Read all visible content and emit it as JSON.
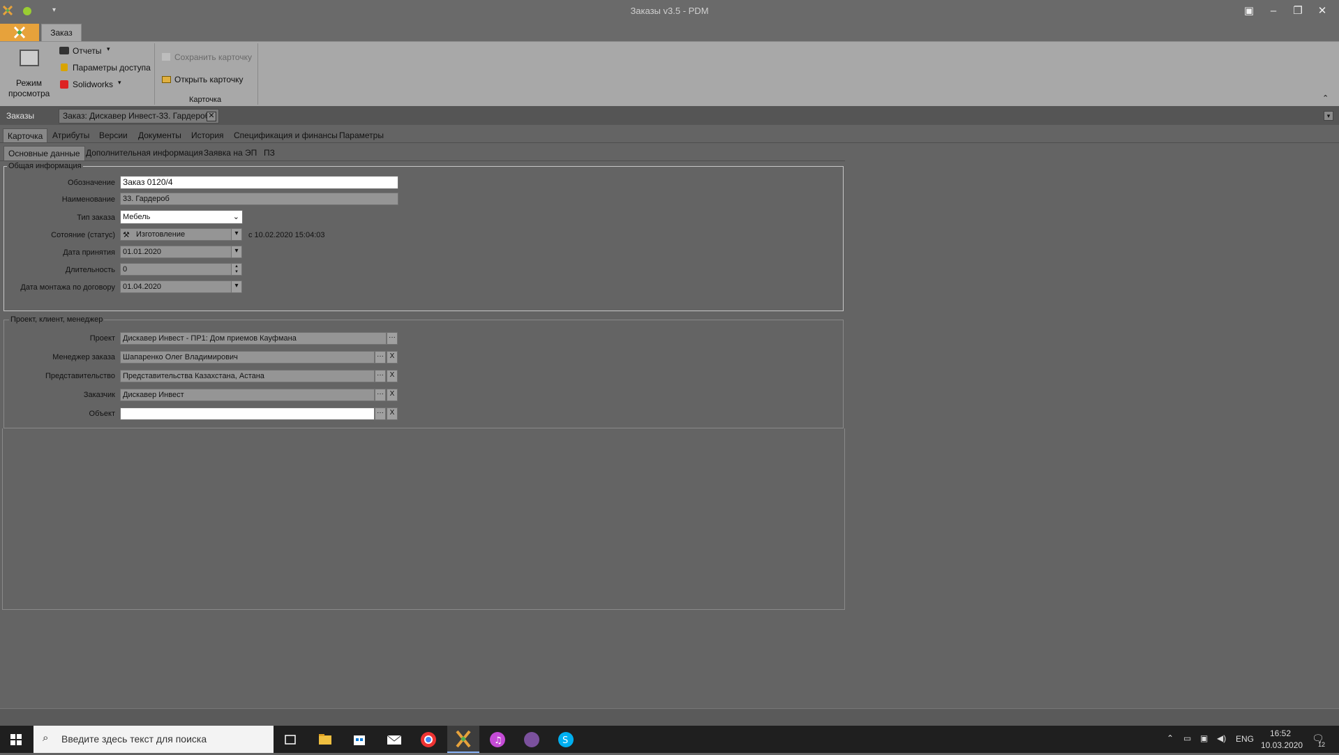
{
  "window": {
    "title": "Заказы v3.5 - PDM"
  },
  "ribbon": {
    "tab": "Заказ",
    "view_mode_line1": "Режим",
    "view_mode_line2": "просмотра",
    "reports": "Отчеты",
    "access_params": "Параметры доступа",
    "solidworks": "Solidworks",
    "save_card": "Сохранить карточку",
    "open_card": "Открыть карточку",
    "group_card": "Карточка"
  },
  "doc_strip": {
    "root_label": "Заказы",
    "open_tab": "Заказ: Дискавер Инвест-33. Гардероб",
    "close_glyph": "✕"
  },
  "tabs_main": [
    "Карточка",
    "Атрибуты",
    "Версии",
    "Документы",
    "История",
    "Спецификация и финансы",
    "Параметры"
  ],
  "tabs_sub": [
    "Основные данные",
    "Дополнительная информация",
    "Заявка на ЭП",
    "ПЗ"
  ],
  "general": {
    "title": "Общая информация",
    "designation_label": "Обозначение",
    "designation_value": "Заказ 0120/4",
    "name_label": "Наименование",
    "name_value": "33. Гардероб",
    "type_label": "Тип заказа",
    "type_value": "Мебель",
    "status_label": "Сотояние (статус)",
    "status_value": "Изготовление",
    "status_since": "с 10.02.2020 15:04:03",
    "accept_date_label": "Дата принятия",
    "accept_date_value": "01.01.2020",
    "duration_label": "Длительность",
    "duration_value": "0",
    "mount_date_label": "Дата монтажа по договору",
    "mount_date_value": "01.04.2020"
  },
  "project": {
    "title": "Проект, клиент, менеджер",
    "project_label": "Проект",
    "project_value": "Дискавер Инвест - ПР1: Дом приемов Кауфмана",
    "manager_label": "Менеджер заказа",
    "manager_value": "Шапаренко Олег Владимирович",
    "office_label": "Представительство",
    "office_value": "Представительства Казахстана, Астана",
    "customer_label": "Заказчик",
    "customer_value": "Дискавер Инвест",
    "object_label": "Объект",
    "object_value": "",
    "dots": "···",
    "clear": "X"
  },
  "taskbar": {
    "search_placeholder": "Введите здесь текст для поиска",
    "lang": "ENG",
    "time": "16:52",
    "date": "10.03.2020",
    "notifications": "12"
  },
  "colors": {
    "app_accent": "#e7a23b",
    "ribbon_bg": "#a8a8a8",
    "content_bg": "#646464"
  }
}
